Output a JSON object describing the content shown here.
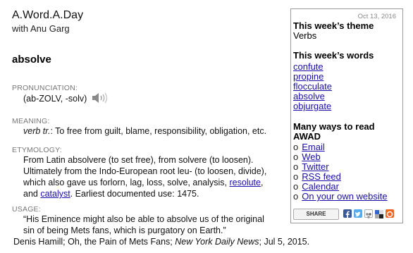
{
  "header": {
    "title": "A.Word.A.Day",
    "byline": "with Anu Garg"
  },
  "word": "absolve",
  "pronunciation": {
    "label": "PRONUNCIATION:",
    "text": "(ab-ZOLV, -solv)"
  },
  "meaning": {
    "label": "MEANING:",
    "pos": "verb tr.",
    "text": ": To free from guilt, blame, responsibility, obligation, etc."
  },
  "etymology": {
    "label": "ETYMOLOGY:",
    "line1": "From Latin absolvere (to set free), from solvere (to loosen).",
    "line2": "Ultimately from the Indo-European root leu- (to loosen, divide),",
    "line3_pre": "which also gave us forlorn, lag, loss, solve, analysis, ",
    "link1": "resolute",
    "line3_post": ",",
    "line4_pre": "and ",
    "link2": "catalyst",
    "line4_post": ". Earliest documented use: 1475."
  },
  "usage": {
    "label": "USAGE:",
    "line1": "“His Eminence might also be able to absolve us of the original",
    "line2": "sin of being Mets fans, which is purgatory on Earth.”",
    "cite_pre": "Denis Hamill; Oh, the Pain of Mets Fans; ",
    "cite_pub": "New York Daily News",
    "cite_post": "; Jul 5, 2015."
  },
  "sidebar": {
    "date": "Oct 13, 2016",
    "theme_heading": "This week’s theme",
    "theme": "Verbs",
    "words_heading": "This week’s words",
    "words": [
      "confute",
      "propine",
      "flocculate",
      "absolve",
      "objurgate"
    ],
    "ways_heading_1": "Many ways to read",
    "ways_heading_2": "AWAD",
    "bullet": "o",
    "ways": [
      "Email",
      "Web",
      "Twitter",
      "RSS feed",
      "Calendar",
      "On your own website"
    ],
    "share_label": "SHARE"
  },
  "colors": {
    "link": "#1a0dab",
    "label_gray": "#777777",
    "border": "#9a9a9a"
  }
}
